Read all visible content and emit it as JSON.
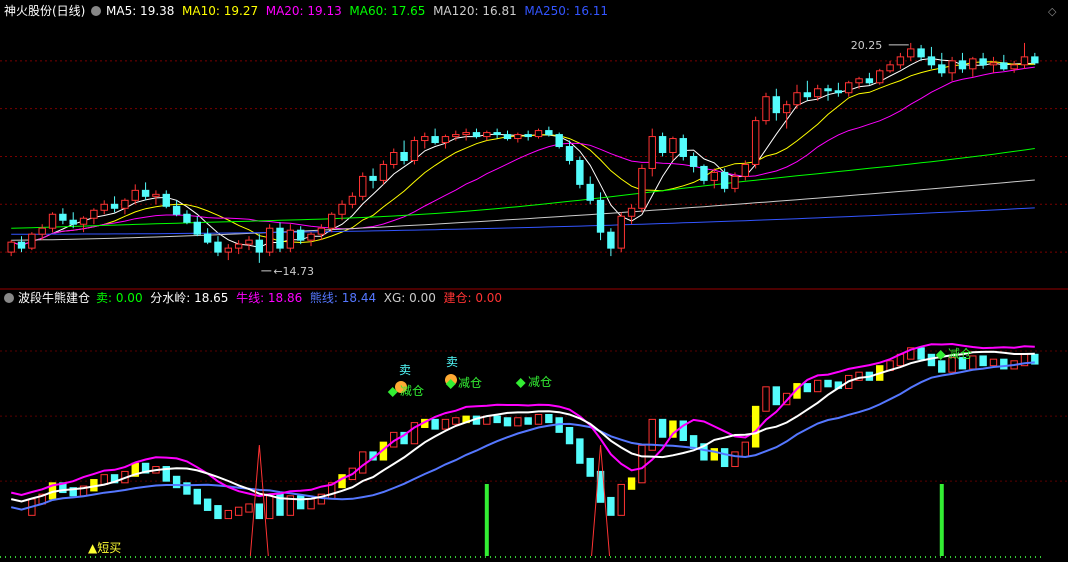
{
  "header": {
    "stock_name": "神火股份(日线)",
    "ma": [
      {
        "label": "MA5:",
        "value": "19.38",
        "color": "#ffffff"
      },
      {
        "label": "MA10:",
        "value": "19.27",
        "color": "#ffff00"
      },
      {
        "label": "MA20:",
        "value": "19.13",
        "color": "#ff00ff"
      },
      {
        "label": "MA60:",
        "value": "17.65",
        "color": "#00ff00"
      },
      {
        "label": "MA120:",
        "value": "16.81",
        "color": "#cccccc"
      },
      {
        "label": "MA250:",
        "value": "16.11",
        "color": "#3355ff"
      }
    ]
  },
  "indicator_header": {
    "name": "波段牛熊建仓",
    "items": [
      {
        "label": "卖:",
        "value": "0.00",
        "color": "#00ff00"
      },
      {
        "label": "分水岭:",
        "value": "18.65",
        "color": "#ffffff"
      },
      {
        "label": "牛线:",
        "value": "18.86",
        "color": "#ff00ff"
      },
      {
        "label": "熊线:",
        "value": "18.44",
        "color": "#5577ff"
      },
      {
        "label": "XG:",
        "value": "0.00",
        "color": "#cccccc"
      },
      {
        "label": "建仓:",
        "value": "0.00",
        "color": "#ff3333"
      }
    ]
  },
  "chart_data": [
    {
      "type": "candlestick",
      "title": "神火股份(日线)",
      "up_color": "#ff3333",
      "down_color": "#54fcfc",
      "annotations": {
        "high_label": "20.25",
        "low_label": "14.73"
      },
      "bars": [
        [
          15.0,
          15.3,
          14.9,
          15.25
        ],
        [
          15.25,
          15.4,
          15.0,
          15.1
        ],
        [
          15.1,
          15.5,
          15.05,
          15.45
        ],
        [
          15.45,
          15.7,
          15.3,
          15.6
        ],
        [
          15.6,
          16.0,
          15.5,
          15.95
        ],
        [
          15.95,
          16.1,
          15.7,
          15.8
        ],
        [
          15.8,
          16.0,
          15.6,
          15.7
        ],
        [
          15.7,
          15.9,
          15.5,
          15.85
        ],
        [
          15.85,
          16.1,
          15.7,
          16.05
        ],
        [
          16.05,
          16.3,
          15.95,
          16.2
        ],
        [
          16.2,
          16.4,
          16.0,
          16.1
        ],
        [
          16.1,
          16.35,
          15.95,
          16.3
        ],
        [
          16.3,
          16.7,
          16.2,
          16.55
        ],
        [
          16.55,
          16.75,
          16.3,
          16.4
        ],
        [
          16.4,
          16.55,
          16.2,
          16.45
        ],
        [
          16.45,
          16.55,
          16.1,
          16.15
        ],
        [
          16.15,
          16.3,
          15.9,
          15.95
        ],
        [
          15.95,
          16.05,
          15.7,
          15.75
        ],
        [
          15.75,
          15.9,
          15.4,
          15.45
        ],
        [
          15.45,
          15.6,
          15.2,
          15.25
        ],
        [
          15.25,
          15.4,
          14.9,
          15.0
        ],
        [
          15.0,
          15.2,
          14.8,
          15.1
        ],
        [
          15.1,
          15.3,
          14.95,
          15.2
        ],
        [
          15.2,
          15.4,
          15.05,
          15.3
        ],
        [
          15.3,
          15.45,
          14.73,
          15.0
        ],
        [
          15.0,
          15.7,
          14.9,
          15.6
        ],
        [
          15.6,
          15.75,
          15.0,
          15.1
        ],
        [
          15.1,
          15.7,
          15.0,
          15.55
        ],
        [
          15.55,
          15.65,
          15.2,
          15.3
        ],
        [
          15.3,
          15.5,
          15.15,
          15.45
        ],
        [
          15.45,
          15.7,
          15.3,
          15.6
        ],
        [
          15.6,
          16.0,
          15.5,
          15.95
        ],
        [
          15.95,
          16.3,
          15.8,
          16.2
        ],
        [
          16.2,
          16.5,
          16.1,
          16.4
        ],
        [
          16.4,
          17.0,
          16.3,
          16.9
        ],
        [
          16.9,
          17.1,
          16.6,
          16.8
        ],
        [
          16.8,
          17.3,
          16.7,
          17.2
        ],
        [
          17.2,
          17.6,
          17.1,
          17.5
        ],
        [
          17.5,
          17.8,
          17.2,
          17.3
        ],
        [
          17.3,
          17.9,
          17.2,
          17.8
        ],
        [
          17.8,
          18.0,
          17.6,
          17.9
        ],
        [
          17.9,
          18.1,
          17.7,
          17.75
        ],
        [
          17.75,
          17.95,
          17.6,
          17.9
        ],
        [
          17.9,
          18.05,
          17.8,
          17.95
        ],
        [
          17.95,
          18.1,
          17.8,
          18.0
        ],
        [
          18.0,
          18.1,
          17.85,
          17.9
        ],
        [
          17.9,
          18.05,
          17.8,
          18.0
        ],
        [
          18.0,
          18.1,
          17.85,
          17.95
        ],
        [
          17.95,
          18.05,
          17.8,
          17.85
        ],
        [
          17.85,
          18.0,
          17.75,
          17.95
        ],
        [
          17.95,
          18.05,
          17.8,
          17.9
        ],
        [
          17.9,
          18.1,
          17.85,
          18.05
        ],
        [
          18.05,
          18.15,
          17.9,
          17.95
        ],
        [
          17.95,
          18.0,
          17.6,
          17.65
        ],
        [
          17.65,
          17.8,
          17.2,
          17.3
        ],
        [
          17.3,
          17.4,
          16.6,
          16.7
        ],
        [
          16.7,
          16.9,
          16.2,
          16.3
        ],
        [
          16.3,
          16.5,
          15.3,
          15.5
        ],
        [
          15.5,
          15.6,
          14.9,
          15.1
        ],
        [
          15.1,
          16.0,
          15.0,
          15.9
        ],
        [
          15.9,
          16.2,
          15.7,
          16.1
        ],
        [
          16.1,
          17.2,
          16.0,
          17.1
        ],
        [
          17.1,
          18.1,
          16.9,
          17.9
        ],
        [
          17.9,
          18.0,
          17.4,
          17.5
        ],
        [
          17.5,
          17.9,
          17.3,
          17.85
        ],
        [
          17.85,
          17.95,
          17.3,
          17.4
        ],
        [
          17.4,
          17.5,
          17.0,
          17.15
        ],
        [
          17.15,
          17.2,
          16.7,
          16.8
        ],
        [
          16.8,
          17.1,
          16.6,
          17.0
        ],
        [
          17.0,
          17.1,
          16.5,
          16.6
        ],
        [
          16.6,
          17.0,
          16.5,
          16.9
        ],
        [
          16.9,
          17.3,
          16.8,
          17.2
        ],
        [
          17.2,
          18.4,
          17.1,
          18.3
        ],
        [
          18.3,
          19.0,
          18.2,
          18.9
        ],
        [
          18.9,
          19.1,
          18.3,
          18.5
        ],
        [
          18.5,
          18.8,
          18.1,
          18.7
        ],
        [
          18.7,
          19.2,
          18.6,
          19.0
        ],
        [
          19.0,
          19.3,
          18.8,
          18.9
        ],
        [
          18.9,
          19.2,
          18.8,
          19.1
        ],
        [
          19.1,
          19.2,
          18.8,
          19.05
        ],
        [
          19.05,
          19.25,
          18.9,
          19.0
        ],
        [
          19.0,
          19.3,
          18.9,
          19.25
        ],
        [
          19.25,
          19.4,
          19.1,
          19.35
        ],
        [
          19.35,
          19.5,
          19.2,
          19.25
        ],
        [
          19.25,
          19.6,
          19.2,
          19.55
        ],
        [
          19.55,
          19.8,
          19.5,
          19.7
        ],
        [
          19.7,
          20.0,
          19.6,
          19.9
        ],
        [
          19.9,
          20.25,
          19.8,
          20.1
        ],
        [
          20.1,
          20.2,
          19.8,
          19.9
        ],
        [
          19.9,
          20.15,
          19.6,
          19.7
        ],
        [
          19.7,
          20.0,
          19.4,
          19.5
        ],
        [
          19.5,
          19.9,
          19.3,
          19.8
        ],
        [
          19.8,
          20.0,
          19.5,
          19.6
        ],
        [
          19.6,
          19.9,
          19.4,
          19.85
        ],
        [
          19.85,
          20.0,
          19.6,
          19.7
        ],
        [
          19.7,
          19.9,
          19.5,
          19.75
        ],
        [
          19.75,
          19.95,
          19.55,
          19.6
        ],
        [
          19.6,
          19.8,
          19.5,
          19.7
        ],
        [
          19.7,
          20.25,
          19.6,
          19.9
        ],
        [
          19.9,
          20.0,
          19.7,
          19.75
        ]
      ]
    },
    {
      "type": "line",
      "title": "波段牛熊建仓",
      "series_names": [
        "分水岭",
        "牛线",
        "熊线"
      ],
      "signal_labels": {
        "sell": "卖",
        "reduce": "减仓",
        "short_buy": "短买"
      }
    }
  ]
}
